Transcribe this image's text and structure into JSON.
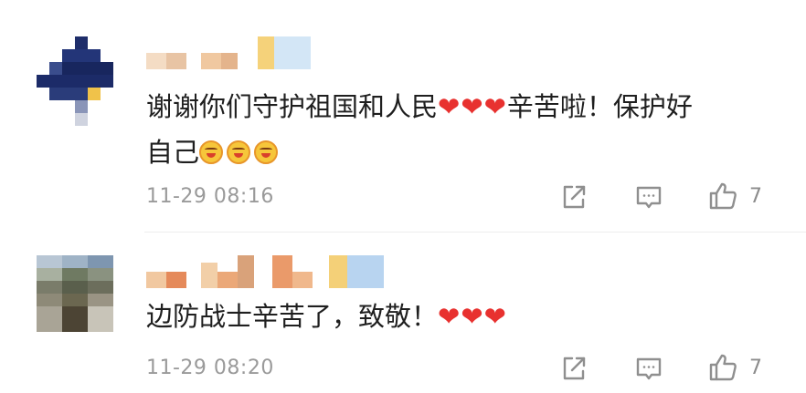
{
  "comments": [
    {
      "username": "",
      "text_prefix": "谢谢你们守护祖国和人民",
      "hearts": "❤❤❤",
      "text_mid": "辛苦啦！保护好",
      "text_line2": "自己",
      "emoji_names": [
        "sweat-laugh-emoji",
        "sweat-laugh-emoji",
        "sweat-laugh-emoji"
      ],
      "time": "11-29 08:16",
      "likes": "7",
      "icons": [
        "share-icon",
        "comment-icon",
        "like-icon"
      ]
    },
    {
      "username": "",
      "text_prefix": "边防战士辛苦了，致敬！",
      "hearts": "❤❤❤",
      "time": "11-29 08:20",
      "likes": "7",
      "icons": [
        "share-icon",
        "comment-icon",
        "like-icon"
      ]
    }
  ],
  "colors": {
    "heart": "#e8312f",
    "meta": "#9a9a9a",
    "icon": "#8f8f8f"
  }
}
